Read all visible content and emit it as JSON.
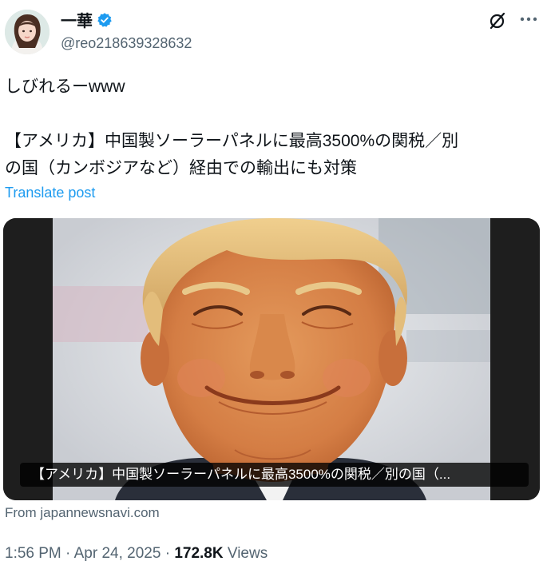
{
  "author": {
    "display_name": "一華",
    "handle": "@reo218639328632",
    "verified": true,
    "icons": {
      "verified": "verified-badge-icon",
      "grok": "grok-icon",
      "more": "more-icon"
    }
  },
  "tweet": {
    "line1": "しびれるーwww",
    "line2": "【アメリカ】中国製ソーラーパネルに最高3500%の関税／別",
    "line3": "の国（カンボジアなど）経由での輸出にも対策",
    "translate_label": "Translate post"
  },
  "card": {
    "caption": "【アメリカ】中国製ソーラーパネルに最高3500%の関税／別の国（...",
    "source": "From japannewsnavi.com"
  },
  "meta": {
    "time": "1:56 PM",
    "sep1": "·",
    "date": "Apr 24, 2025",
    "sep2": "·",
    "views_count": "172.8K",
    "views_label": "Views"
  },
  "colors": {
    "accent": "#1d9bf0",
    "text": "#0f1419",
    "secondary": "#536471"
  }
}
